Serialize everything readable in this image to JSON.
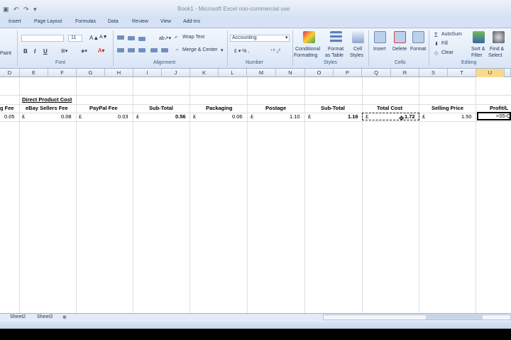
{
  "window": {
    "title": "Book1 - Microsoft Excel non-commercial use",
    "qat": "▣ ↶ ↷ ▾"
  },
  "tabs": [
    "Insert",
    "Page Layout",
    "Formulas",
    "Data",
    "Review",
    "View",
    "Add-Ins"
  ],
  "ribbon": {
    "font": {
      "size": "11",
      "label": "Font",
      "paste": "Paint"
    },
    "alignment": {
      "wrap": "Wrap Text",
      "merge": "Merge & Center",
      "label": "Alignment"
    },
    "number": {
      "format": "Accounting",
      "label": "Number",
      "symbols": "£ ▾  %  ,"
    },
    "styles": {
      "cond1": "Conditional",
      "cond2": "Formatting",
      "tbl1": "Format",
      "tbl2": "as Table",
      "cell1": "Cell",
      "cell2": "Styles",
      "label": "Styles"
    },
    "cells": {
      "insert": "Insert",
      "delete": "Delete",
      "format": "Format",
      "label": "Cells"
    },
    "editing": {
      "autosum": "AutoSum",
      "fill": "Fill",
      "clear": "Clear",
      "sort1": "Sort &",
      "sort2": "Filter",
      "find1": "Find &",
      "find2": "Select",
      "label": "Editing"
    }
  },
  "columns": [
    "D",
    "E",
    "F",
    "G",
    "H",
    "I",
    "J",
    "K",
    "L",
    "M",
    "N",
    "O",
    "P",
    "Q",
    "R",
    "S",
    "T",
    "U"
  ],
  "headers": {
    "section": "Direct Product Cost",
    "d": "g Fee",
    "ebay": "eBay Sellers Fee",
    "paypal": "PayPal Fee",
    "subtotal1": "Sub-Total",
    "packaging": "Packaging",
    "postage": "Postage",
    "subtotal2": "Sub-Total",
    "total": "Total Cost",
    "selling": "Selling Price",
    "profit": "Profit/L"
  },
  "row": {
    "d": "0.05",
    "ebay_cur": "£",
    "ebay": "0.08",
    "paypal_cur": "£",
    "paypal": "0.03",
    "sub1_cur": "£",
    "sub1": "0.56",
    "pack_cur": "£",
    "pack": "0.06",
    "post_cur": "£",
    "post": "1.10",
    "sub2_cur": "£",
    "sub2": "1.16",
    "total_cur": "£",
    "total": "1.72",
    "sell_cur": "£",
    "sell": "1.50",
    "profit": "=S5-Q"
  },
  "sheets": [
    "Sheet2",
    "Sheet3"
  ],
  "colors": {
    "accent": "#f9d98b",
    "ribbon": "#dbe6f5"
  }
}
